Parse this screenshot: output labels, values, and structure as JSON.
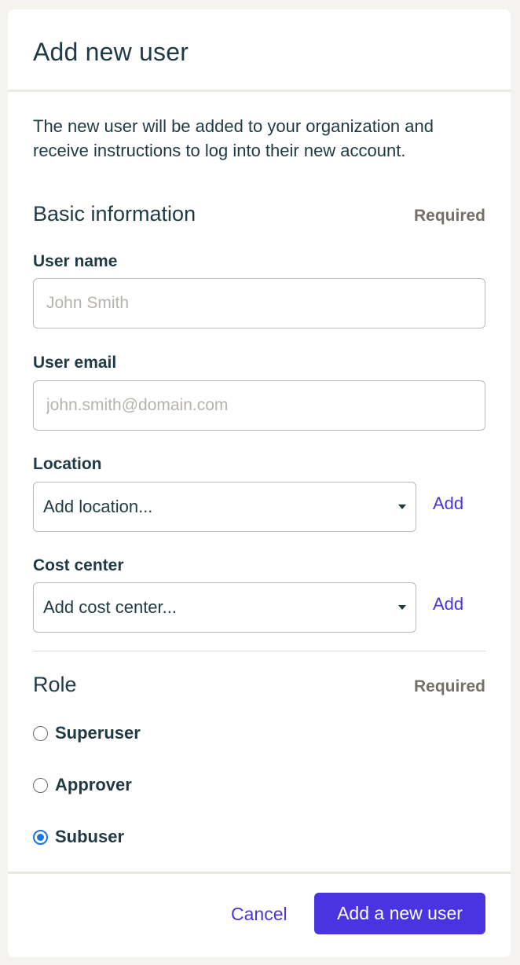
{
  "modal": {
    "title": "Add new user",
    "intro": "The new user will be added to your organization and receive instructions to log into their new account."
  },
  "basic_info": {
    "title": "Basic information",
    "required": "Required",
    "user_name": {
      "label": "User name",
      "value": "",
      "placeholder": "John Smith"
    },
    "user_email": {
      "label": "User email",
      "value": "",
      "placeholder": "john.smith@domain.com"
    },
    "location": {
      "label": "Location",
      "value": "Add location...",
      "add_label": "Add"
    },
    "cost_center": {
      "label": "Cost center",
      "value": "Add cost center...",
      "add_label": "Add"
    }
  },
  "role": {
    "title": "Role",
    "required": "Required",
    "options": [
      {
        "label": "Superuser",
        "checked": false
      },
      {
        "label": "Approver",
        "checked": false
      },
      {
        "label": "Subuser",
        "checked": true
      }
    ]
  },
  "footer": {
    "cancel_label": "Cancel",
    "submit_label": "Add a new user"
  },
  "colors": {
    "accent": "#4a33e0",
    "text": "#1f3a44",
    "muted": "#747068",
    "radio_checked": "#1a73e8",
    "background": "#f4f3ef"
  }
}
